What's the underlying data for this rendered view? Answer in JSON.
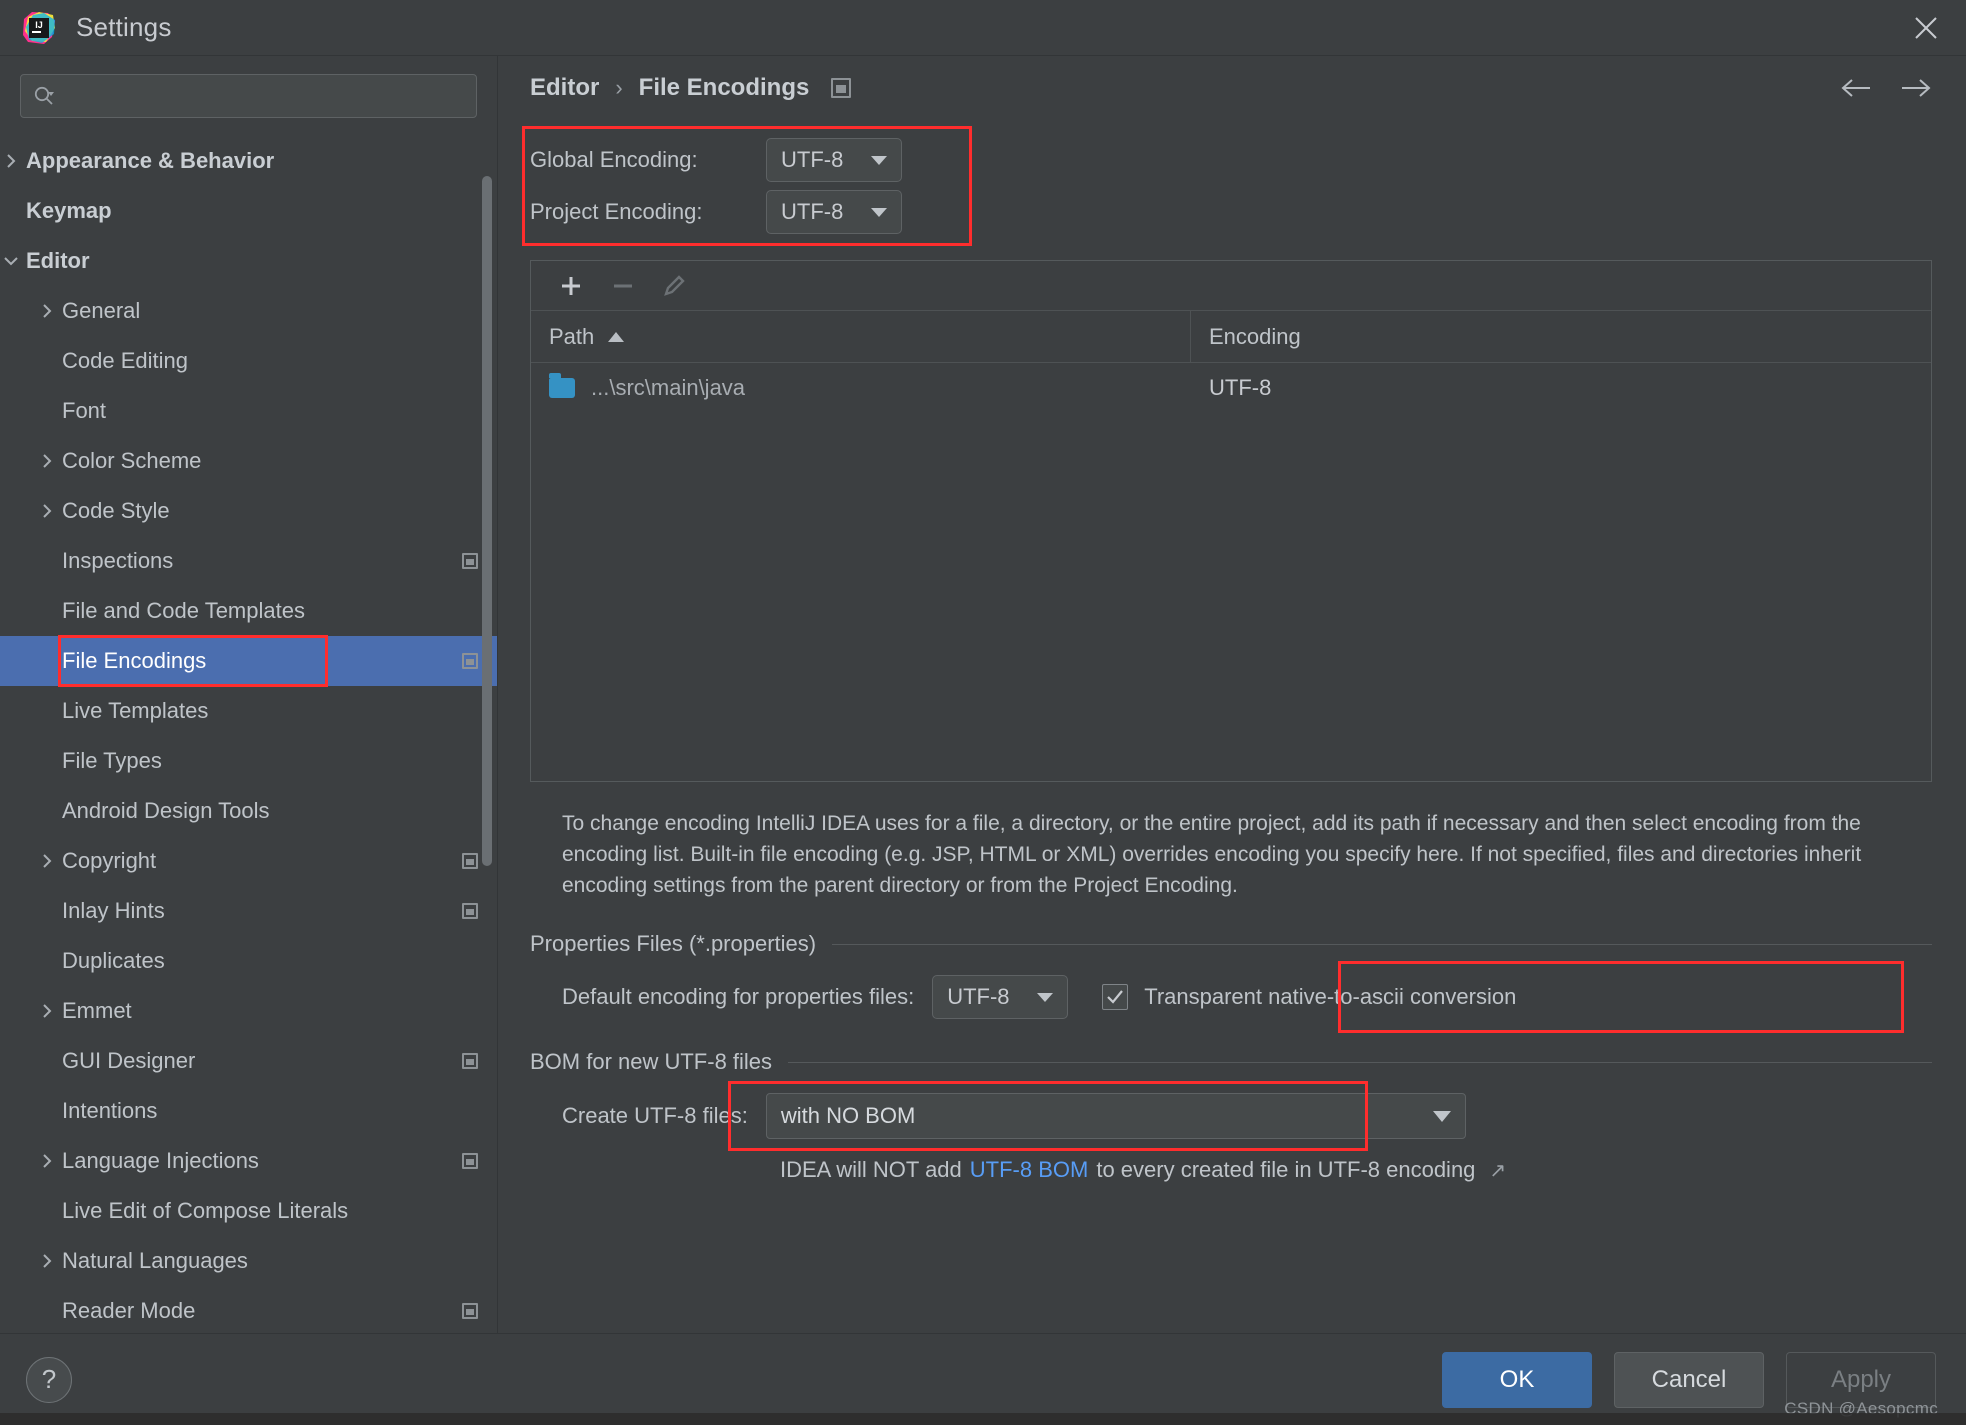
{
  "window": {
    "title": "Settings",
    "logo_icon": "intellij-idea-logo",
    "close_icon": "close-icon"
  },
  "search": {
    "placeholder": "",
    "value": "",
    "icon": "search-icon"
  },
  "sidebar": {
    "items": [
      {
        "label": "Appearance & Behavior",
        "level": 0,
        "bold": true,
        "chevron": "chevron-right-icon",
        "trailing": false,
        "selected": false
      },
      {
        "label": "Keymap",
        "level": 0,
        "bold": true,
        "chevron": "",
        "trailing": false,
        "selected": false
      },
      {
        "label": "Editor",
        "level": 0,
        "bold": true,
        "chevron": "chevron-down-icon",
        "trailing": false,
        "selected": false
      },
      {
        "label": "General",
        "level": 1,
        "bold": false,
        "chevron": "chevron-right-icon",
        "trailing": false,
        "selected": false
      },
      {
        "label": "Code Editing",
        "level": 1,
        "bold": false,
        "chevron": "",
        "trailing": false,
        "selected": false
      },
      {
        "label": "Font",
        "level": 1,
        "bold": false,
        "chevron": "",
        "trailing": false,
        "selected": false
      },
      {
        "label": "Color Scheme",
        "level": 1,
        "bold": false,
        "chevron": "chevron-right-icon",
        "trailing": false,
        "selected": false
      },
      {
        "label": "Code Style",
        "level": 1,
        "bold": false,
        "chevron": "chevron-right-icon",
        "trailing": false,
        "selected": false
      },
      {
        "label": "Inspections",
        "level": 1,
        "bold": false,
        "chevron": "",
        "trailing": true,
        "selected": false
      },
      {
        "label": "File and Code Templates",
        "level": 1,
        "bold": false,
        "chevron": "",
        "trailing": false,
        "selected": false
      },
      {
        "label": "File Encodings",
        "level": 1,
        "bold": false,
        "chevron": "",
        "trailing": true,
        "selected": true
      },
      {
        "label": "Live Templates",
        "level": 1,
        "bold": false,
        "chevron": "",
        "trailing": false,
        "selected": false
      },
      {
        "label": "File Types",
        "level": 1,
        "bold": false,
        "chevron": "",
        "trailing": false,
        "selected": false
      },
      {
        "label": "Android Design Tools",
        "level": 1,
        "bold": false,
        "chevron": "",
        "trailing": false,
        "selected": false
      },
      {
        "label": "Copyright",
        "level": 1,
        "bold": false,
        "chevron": "chevron-right-icon",
        "trailing": true,
        "selected": false
      },
      {
        "label": "Inlay Hints",
        "level": 1,
        "bold": false,
        "chevron": "",
        "trailing": true,
        "selected": false
      },
      {
        "label": "Duplicates",
        "level": 1,
        "bold": false,
        "chevron": "",
        "trailing": false,
        "selected": false
      },
      {
        "label": "Emmet",
        "level": 1,
        "bold": false,
        "chevron": "chevron-right-icon",
        "trailing": false,
        "selected": false
      },
      {
        "label": "GUI Designer",
        "level": 1,
        "bold": false,
        "chevron": "",
        "trailing": true,
        "selected": false
      },
      {
        "label": "Intentions",
        "level": 1,
        "bold": false,
        "chevron": "",
        "trailing": false,
        "selected": false
      },
      {
        "label": "Language Injections",
        "level": 1,
        "bold": false,
        "chevron": "chevron-right-icon",
        "trailing": true,
        "selected": false
      },
      {
        "label": "Live Edit of Compose Literals",
        "level": 1,
        "bold": false,
        "chevron": "",
        "trailing": false,
        "selected": false
      },
      {
        "label": "Natural Languages",
        "level": 1,
        "bold": false,
        "chevron": "chevron-right-icon",
        "trailing": false,
        "selected": false
      },
      {
        "label": "Reader Mode",
        "level": 1,
        "bold": false,
        "chevron": "",
        "trailing": true,
        "selected": false
      }
    ]
  },
  "breadcrumb": {
    "parent": "Editor",
    "separator": "›",
    "current": "File Encodings",
    "icon": "settings-badge-icon",
    "back_icon": "arrow-left-icon",
    "forward_icon": "arrow-right-icon"
  },
  "encoding": {
    "global_label": "Global Encoding:",
    "global_value": "UTF-8",
    "project_label": "Project Encoding:",
    "project_value": "UTF-8"
  },
  "toolbar": {
    "add_icon": "plus-icon",
    "remove_icon": "minus-icon",
    "edit_icon": "pencil-icon"
  },
  "table": {
    "columns": [
      "Path",
      "Encoding"
    ],
    "sort_column": "Path",
    "sort_direction": "asc",
    "rows": [
      {
        "path": "...\\src\\main\\java",
        "encoding": "UTF-8",
        "icon": "folder-icon"
      }
    ]
  },
  "description": "To change encoding IntelliJ IDEA uses for a file, a directory, or the entire project, add its path if necessary and then select encoding from the encoding list. Built-in file encoding (e.g. JSP, HTML or XML) overrides encoding you specify here. If not specified, files and directories inherit encoding settings from the parent directory or from the Project Encoding.",
  "properties_section": {
    "title": "Properties Files (*.properties)",
    "default_encoding_label": "Default encoding for properties files:",
    "default_encoding_value": "UTF-8",
    "transparent_checkbox_label": "Transparent native-to-ascii conversion",
    "transparent_checkbox_checked": true
  },
  "bom_section": {
    "title": "BOM for new UTF-8 files",
    "create_label": "Create UTF-8 files:",
    "create_value": "with NO BOM",
    "note_prefix": "IDEA will NOT add",
    "note_link": "UTF-8 BOM",
    "note_suffix": "to every created file in UTF-8 encoding",
    "external_link_icon": "external-link-icon"
  },
  "footer": {
    "help_label": "?",
    "ok_label": "OK",
    "cancel_label": "Cancel",
    "apply_label": "Apply",
    "apply_enabled": false,
    "watermark": "CSDN @Aesopcmc"
  },
  "colors": {
    "accent_blue": "#4b6eaf",
    "annotation_red": "#ff2d2d",
    "link_blue": "#589df6",
    "folder_blue": "#3592c4",
    "panel_bg": "#3c3f41",
    "ok_button": "#3c6ba3"
  }
}
